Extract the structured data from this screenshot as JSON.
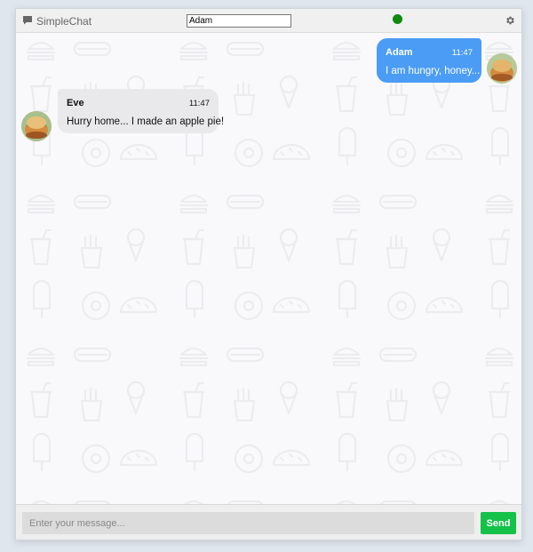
{
  "app": {
    "title": "SimpleChat",
    "icon": "chat-bubble-icon"
  },
  "header": {
    "username_value": "Adam",
    "status_color": "#0f8a0f",
    "settings_icon": "gear-icon"
  },
  "messages": [
    {
      "sender": "Adam",
      "time": "11:47",
      "text": "I am hungry, honey...",
      "direction": "outgoing"
    },
    {
      "sender": "Eve",
      "time": "11:47",
      "text": "Hurry home... I made an apple pie!",
      "direction": "incoming"
    }
  ],
  "composer": {
    "placeholder": "Enter your message...",
    "send_label": "Send"
  },
  "colors": {
    "outgoing_bubble": "#4a9cf5",
    "incoming_bubble": "#e9e9eb",
    "send_button": "#14c24a"
  }
}
